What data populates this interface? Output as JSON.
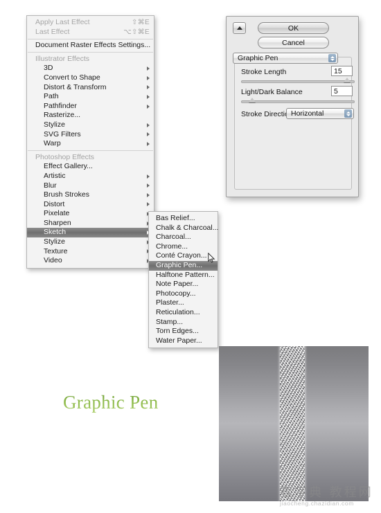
{
  "main_menu": {
    "items": [
      {
        "label": "Apply Last Effect",
        "shortcut": "⇧⌘E",
        "state": "disabled",
        "arrow": false,
        "indent": false
      },
      {
        "label": "Last Effect",
        "shortcut": "⌥⇧⌘E",
        "state": "disabled",
        "arrow": false,
        "indent": false
      },
      {
        "separator": true
      },
      {
        "label": "Document Raster Effects Settings...",
        "shortcut": "",
        "state": "normal",
        "arrow": false,
        "indent": false
      },
      {
        "separator": true
      },
      {
        "label": "Illustrator Effects",
        "shortcut": "",
        "state": "group",
        "arrow": false,
        "indent": false
      },
      {
        "label": "3D",
        "shortcut": "",
        "state": "normal",
        "arrow": true,
        "indent": true
      },
      {
        "label": "Convert to Shape",
        "shortcut": "",
        "state": "normal",
        "arrow": true,
        "indent": true
      },
      {
        "label": "Distort & Transform",
        "shortcut": "",
        "state": "normal",
        "arrow": true,
        "indent": true
      },
      {
        "label": "Path",
        "shortcut": "",
        "state": "normal",
        "arrow": true,
        "indent": true
      },
      {
        "label": "Pathfinder",
        "shortcut": "",
        "state": "normal",
        "arrow": true,
        "indent": true
      },
      {
        "label": "Rasterize...",
        "shortcut": "",
        "state": "normal",
        "arrow": false,
        "indent": true
      },
      {
        "label": "Stylize",
        "shortcut": "",
        "state": "normal",
        "arrow": true,
        "indent": true
      },
      {
        "label": "SVG Filters",
        "shortcut": "",
        "state": "normal",
        "arrow": true,
        "indent": true
      },
      {
        "label": "Warp",
        "shortcut": "",
        "state": "normal",
        "arrow": true,
        "indent": true
      },
      {
        "separator": true
      },
      {
        "label": "Photoshop Effects",
        "shortcut": "",
        "state": "group",
        "arrow": false,
        "indent": false
      },
      {
        "label": "Effect Gallery...",
        "shortcut": "",
        "state": "normal",
        "arrow": false,
        "indent": true
      },
      {
        "label": "Artistic",
        "shortcut": "",
        "state": "normal",
        "arrow": true,
        "indent": true
      },
      {
        "label": "Blur",
        "shortcut": "",
        "state": "normal",
        "arrow": true,
        "indent": true
      },
      {
        "label": "Brush Strokes",
        "shortcut": "",
        "state": "normal",
        "arrow": true,
        "indent": true
      },
      {
        "label": "Distort",
        "shortcut": "",
        "state": "normal",
        "arrow": true,
        "indent": true
      },
      {
        "label": "Pixelate",
        "shortcut": "",
        "state": "normal",
        "arrow": true,
        "indent": true
      },
      {
        "label": "Sharpen",
        "shortcut": "",
        "state": "normal",
        "arrow": true,
        "indent": true
      },
      {
        "label": "Sketch",
        "shortcut": "",
        "state": "selected",
        "arrow": true,
        "indent": true
      },
      {
        "label": "Stylize",
        "shortcut": "",
        "state": "normal",
        "arrow": true,
        "indent": true
      },
      {
        "label": "Texture",
        "shortcut": "",
        "state": "normal",
        "arrow": true,
        "indent": true
      },
      {
        "label": "Video",
        "shortcut": "",
        "state": "normal",
        "arrow": true,
        "indent": true
      }
    ]
  },
  "sub_menu": {
    "parent": "Sketch",
    "items": [
      {
        "label": "Bas Relief...",
        "state": "normal"
      },
      {
        "label": "Chalk & Charcoal...",
        "state": "normal"
      },
      {
        "label": "Charcoal...",
        "state": "normal"
      },
      {
        "label": "Chrome...",
        "state": "normal"
      },
      {
        "label": "Conté Crayon...",
        "state": "normal"
      },
      {
        "label": "Graphic Pen...",
        "state": "selected"
      },
      {
        "label": "Halftone Pattern...",
        "state": "normal"
      },
      {
        "label": "Note Paper...",
        "state": "normal"
      },
      {
        "label": "Photocopy...",
        "state": "normal"
      },
      {
        "label": "Plaster...",
        "state": "normal"
      },
      {
        "label": "Reticulation...",
        "state": "normal"
      },
      {
        "label": "Stamp...",
        "state": "normal"
      },
      {
        "label": "Torn Edges...",
        "state": "normal"
      },
      {
        "label": "Water Paper...",
        "state": "normal"
      }
    ]
  },
  "dialog": {
    "ok_label": "OK",
    "cancel_label": "Cancel",
    "effect_select": "Graphic Pen",
    "stroke_length": {
      "label": "Stroke Length",
      "value": "15",
      "slider_percent": 96
    },
    "light_dark_balance": {
      "label": "Light/Dark Balance",
      "value": "5",
      "slider_percent": 7
    },
    "stroke_direction": {
      "label": "Stroke Direction:",
      "value": "Horizontal"
    }
  },
  "preview": {
    "caption": "Graphic Pen"
  },
  "watermark": {
    "title": "查字典 教程网",
    "url": "jiaocheng.chazidian.com"
  },
  "colors": {
    "menu_bg": "#f3f3f3",
    "menu_selected": "#7b7b7b",
    "dialog_bg": "#e9e9e9",
    "caption_green": "#8fbb4d"
  }
}
